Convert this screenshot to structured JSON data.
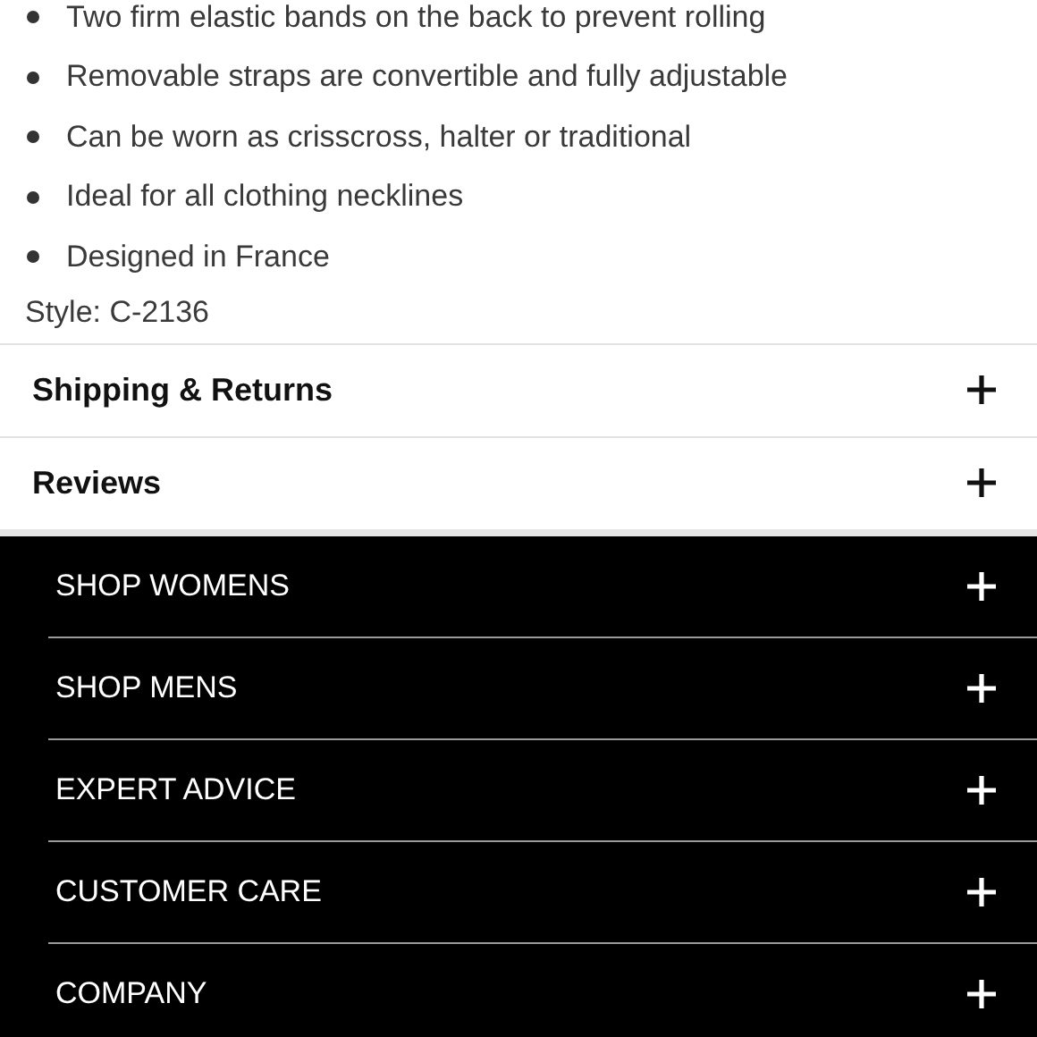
{
  "features": [
    "Two firm elastic bands on the back to prevent rolling",
    "Removable straps are convertible and fully adjustable",
    "Can be worn as crisscross, halter or traditional",
    "Ideal for all clothing necklines",
    "Designed in France"
  ],
  "style": "Style: C-2136",
  "sections": [
    {
      "title": "Shipping & Returns",
      "expanded": false
    },
    {
      "title": "Reviews",
      "expanded": false
    }
  ],
  "footer_menu": [
    {
      "label": "SHOP WOMENS",
      "expanded": false
    },
    {
      "label": "SHOP MENS",
      "expanded": false
    },
    {
      "label": "EXPERT ADVICE",
      "expanded": false
    },
    {
      "label": "CUSTOMER CARE",
      "expanded": false
    },
    {
      "label": "COMPANY",
      "expanded": false
    }
  ]
}
